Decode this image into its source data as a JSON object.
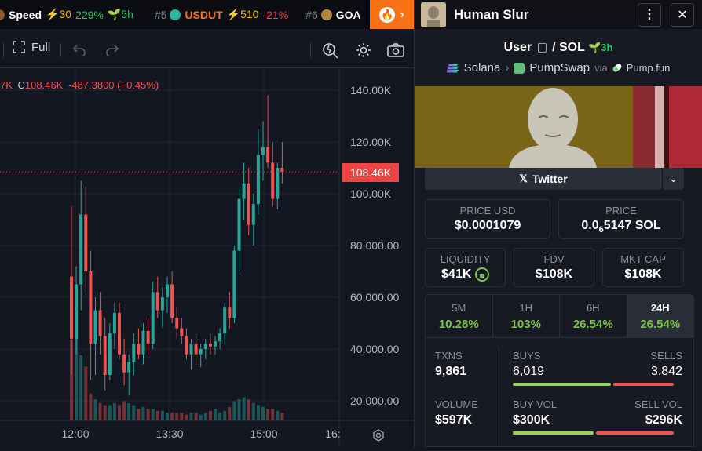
{
  "ticker": [
    {
      "rank": "",
      "name": "Speed",
      "boost": "⚡30",
      "change": "229%",
      "age": "5h",
      "name_color": "#ffffff",
      "logo_color": "#8a5a2a"
    },
    {
      "rank": "#5",
      "name": "USDUT",
      "boost": "⚡510",
      "change": "-21%",
      "age": "",
      "name_color": "#f97316",
      "logo_color": "#2bb59a"
    },
    {
      "rank": "#6",
      "name": "GOA",
      "boost": "",
      "change": "",
      "age": "",
      "name_color": "#ffffff",
      "logo_color": "#b08a3a"
    }
  ],
  "toolbar": {
    "full_label": "Full"
  },
  "chart_data": {
    "type": "candlestick",
    "ohlc_label": "C",
    "close_label": "108.46K",
    "change_label": "-487.3800 (−0.45%)",
    "left_clip": "7K",
    "current_price_tag": "108.46K",
    "y_ticks": [
      "140.00K",
      "120.00K",
      "100.00K",
      "80,000.00",
      "60,000.00",
      "40,000.00",
      "20,000.00"
    ],
    "x_ticks": [
      "12:00",
      "13:30",
      "15:00",
      "16:"
    ],
    "ylim": [
      0,
      145000
    ],
    "candles": [
      [
        68000,
        95000,
        30000,
        44000
      ],
      [
        44000,
        72000,
        38000,
        65000
      ],
      [
        65000,
        105000,
        55000,
        92000
      ],
      [
        92000,
        103000,
        62000,
        70000
      ],
      [
        70000,
        78000,
        28000,
        42000
      ],
      [
        42000,
        60000,
        30000,
        55000
      ],
      [
        55000,
        62000,
        38000,
        45000
      ],
      [
        45000,
        52000,
        24000,
        30000
      ],
      [
        30000,
        50000,
        28000,
        46000
      ],
      [
        46000,
        58000,
        40000,
        54000
      ],
      [
        54000,
        58000,
        36000,
        38000
      ],
      [
        38000,
        44000,
        26000,
        31000
      ],
      [
        31000,
        38000,
        22000,
        35000
      ],
      [
        35000,
        46000,
        30000,
        42000
      ],
      [
        42000,
        48000,
        36000,
        38000
      ],
      [
        38000,
        50000,
        34000,
        47000
      ],
      [
        47000,
        52000,
        38000,
        42000
      ],
      [
        42000,
        66000,
        40000,
        62000
      ],
      [
        62000,
        68000,
        52000,
        55000
      ],
      [
        55000,
        64000,
        48000,
        60000
      ],
      [
        60000,
        68000,
        54000,
        65000
      ],
      [
        65000,
        70000,
        50000,
        52000
      ],
      [
        52000,
        56000,
        44000,
        48000
      ],
      [
        48000,
        52000,
        42000,
        45000
      ],
      [
        45000,
        48000,
        36000,
        38000
      ],
      [
        38000,
        44000,
        32000,
        42000
      ],
      [
        42000,
        46000,
        34000,
        38000
      ],
      [
        38000,
        42000,
        33000,
        40000
      ],
      [
        40000,
        44000,
        36000,
        42000
      ],
      [
        42000,
        46000,
        38000,
        41000
      ],
      [
        41000,
        45000,
        38000,
        43000
      ],
      [
        43000,
        48000,
        40000,
        46000
      ],
      [
        46000,
        58000,
        42000,
        56000
      ],
      [
        56000,
        62000,
        48000,
        52000
      ],
      [
        52000,
        80000,
        50000,
        78000
      ],
      [
        78000,
        102000,
        70000,
        98000
      ],
      [
        98000,
        112000,
        90000,
        104000
      ],
      [
        104000,
        110000,
        84000,
        88000
      ],
      [
        88000,
        100000,
        80000,
        96000
      ],
      [
        96000,
        125000,
        92000,
        115000
      ],
      [
        115000,
        128000,
        105000,
        118000
      ],
      [
        118000,
        138000,
        110000,
        112000
      ],
      [
        112000,
        120000,
        95000,
        98000
      ],
      [
        98000,
        112000,
        94000,
        110000
      ],
      [
        110000,
        120000,
        104000,
        108460
      ]
    ],
    "volumes": [
      42,
      43,
      34,
      28,
      14,
      11,
      9,
      8,
      8,
      9,
      8,
      10,
      9,
      8,
      6,
      7,
      6,
      6,
      5,
      5,
      4,
      4,
      4,
      4,
      3,
      4,
      4,
      3,
      4,
      5,
      6,
      4,
      5,
      7,
      10,
      11,
      12,
      11,
      9,
      8,
      7,
      6,
      6,
      5,
      4
    ],
    "vol_max": 45
  },
  "header": {
    "title": "Human Slur"
  },
  "pair": {
    "base": "User",
    "quote": "SOL",
    "age": "3h"
  },
  "chain": {
    "chain": "Solana",
    "dex": "PumpSwap",
    "via": "via",
    "launchpad": "Pump.fun"
  },
  "twitter": {
    "label": "Twitter"
  },
  "price": {
    "usd_label": "PRICE USD",
    "usd": "$0.0001079",
    "sol_label": "PRICE",
    "sol_prefix": "0.0",
    "sol_zeros": "6",
    "sol_rest": "5147 SOL"
  },
  "metrics": {
    "liq_label": "LIQUIDITY",
    "liq": "$41K",
    "fdv_label": "FDV",
    "fdv": "$108K",
    "mcap_label": "MKT CAP",
    "mcap": "$108K"
  },
  "timeframes": [
    {
      "label": "5M",
      "pct": "10.28%"
    },
    {
      "label": "1H",
      "pct": "103%"
    },
    {
      "label": "6H",
      "pct": "26.54%"
    },
    {
      "label": "24H",
      "pct": "26.54%"
    }
  ],
  "stats": {
    "txns_label": "TXNS",
    "txns": "9,861",
    "buys_label": "BUYS",
    "buys": "6,019",
    "sells_label": "SELLS",
    "sells": "3,842",
    "buys_frac": 0.61,
    "volume_label": "VOLUME",
    "volume": "$597K",
    "buyvol_label": "BUY VOL",
    "buyvol": "$300K",
    "sellvol_label": "SELL VOL",
    "sellvol": "$296K",
    "buyvol_frac": 0.503
  },
  "colors": {
    "up": "#26a69a",
    "down": "#ef5350",
    "accent": "#f97316",
    "positive": "#7cc04a",
    "buy_bar": "#9ccf5a",
    "sell_bar": "#ef5350"
  }
}
